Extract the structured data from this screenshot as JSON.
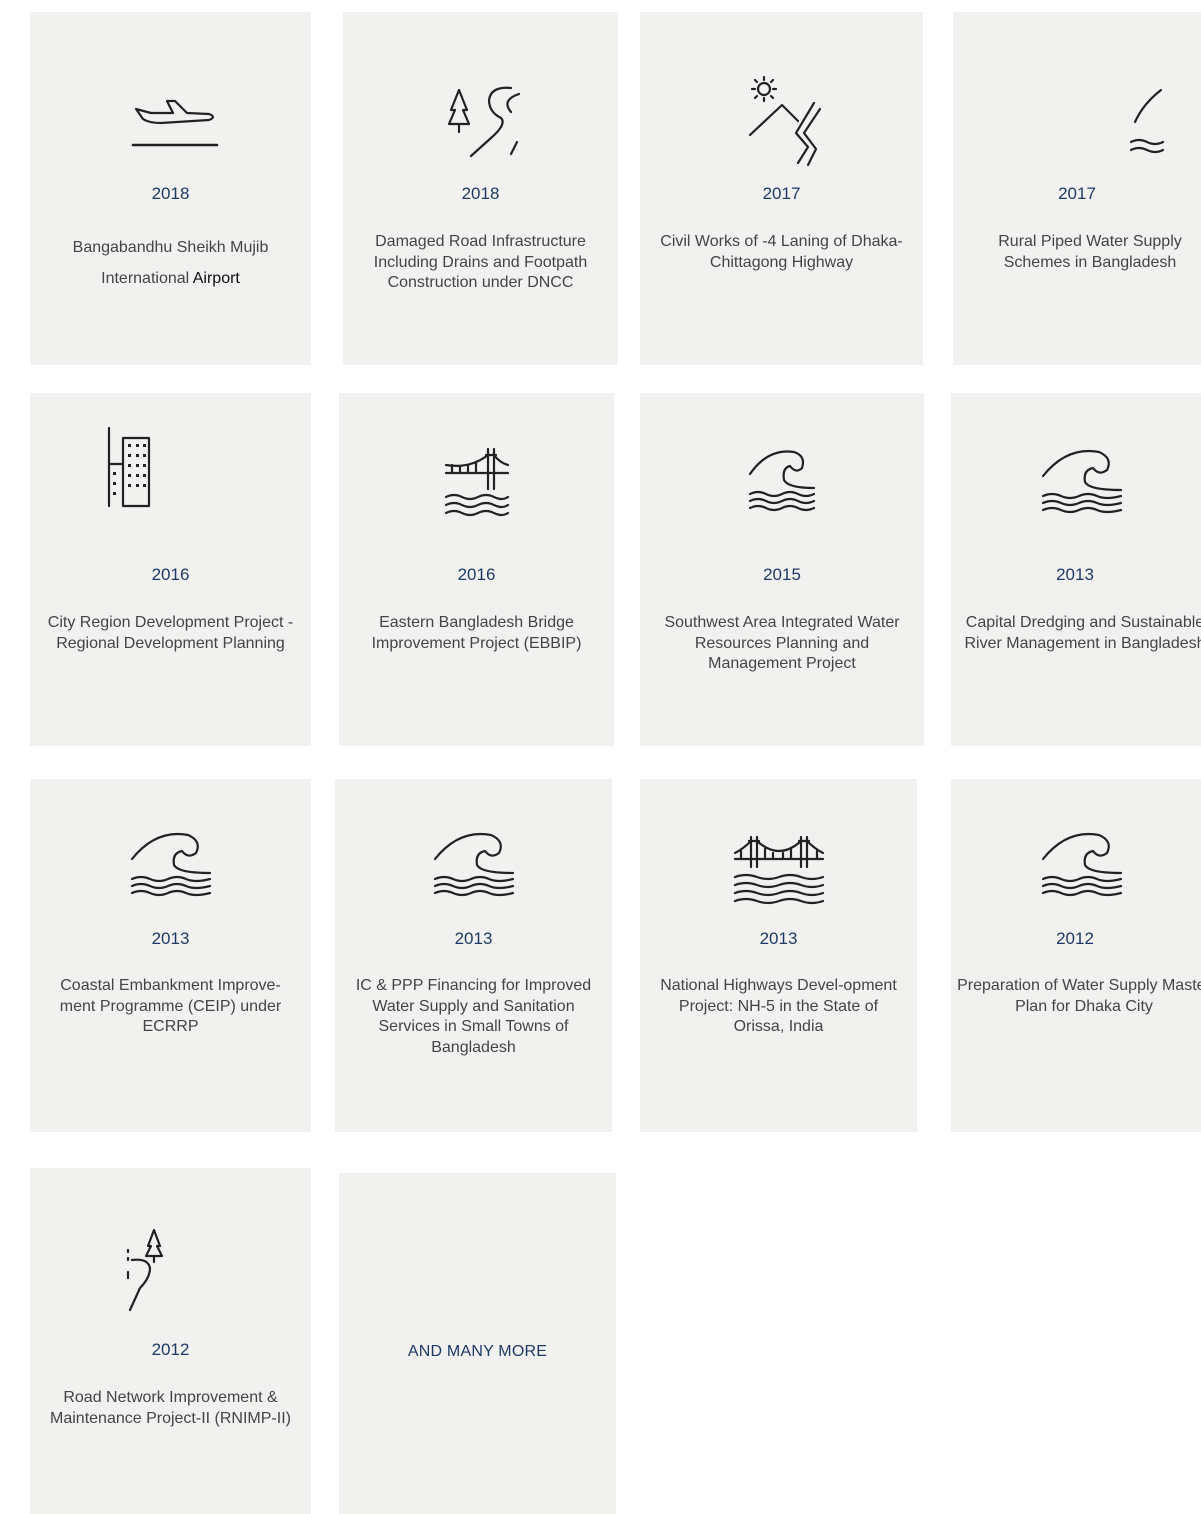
{
  "projects": [
    {
      "year": "2018",
      "title": "Bangabandhu Sheikh Mujib International",
      "title_highlight": "Airport",
      "icon": "airplane-takeoff-icon"
    },
    {
      "year": "2018",
      "title": "Damaged Road Infrastructure Including Drains and Footpath Construction under DNCC",
      "icon": "road-tree-icon"
    },
    {
      "year": "2017",
      "title": "Civil Works of -4 Laning of Dhaka-Chittagong Highway",
      "icon": "mountain-sun-road-icon"
    },
    {
      "year": "2017",
      "title": "Rural Piped Water Supply Schemes in Bangladesh",
      "icon": "water-curve-icon"
    },
    {
      "year": "2016",
      "title": "City Region Development Project - Regional Development Planning",
      "icon": "building-icon"
    },
    {
      "year": "2016",
      "title": "Eastern Bangladesh Bridge Improvement Project (EBBIP)",
      "icon": "bridge-water-icon"
    },
    {
      "year": "2015",
      "title": "Southwest Area Integrated Water Resources Planning and Management Project",
      "icon": "wave-icon"
    },
    {
      "year": "2013",
      "title": "Capital Dredging and Sustainable River Management in Bangladesh",
      "icon": "wave-icon"
    },
    {
      "year": "2013",
      "title": "Coastal Embankment Improve-ment Programme (CEIP) under ECRRP",
      "icon": "wave-icon"
    },
    {
      "year": "2013",
      "title": "IC & PPP Financing for Improved Water Supply and Sanitation Services in Small Towns of Bangladesh",
      "icon": "wave-icon"
    },
    {
      "year": "2013",
      "title": "National Highways Devel-opment Project: NH-5 in the State of Orissa, India",
      "icon": "suspension-bridge-icon"
    },
    {
      "year": "2012",
      "title": "Preparation of Water Supply Master Plan for Dhaka City",
      "icon": "wave-icon"
    },
    {
      "year": "2012",
      "title": "Road Network Improvement & Maintenance Project-II (RNIMP-II)",
      "icon": "road-tree-icon"
    }
  ],
  "more_label": "AND MANY MORE",
  "colors": {
    "card_bg": "#f1f1f0",
    "year": "#1d3a66",
    "text": "#444444"
  }
}
